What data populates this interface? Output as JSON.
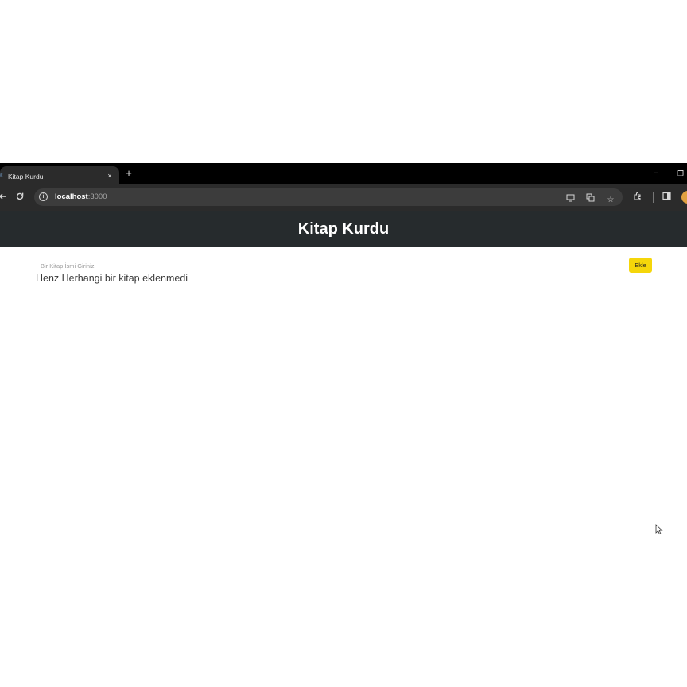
{
  "browser": {
    "tab_title": "Kitap Kurdu",
    "tab_close": "×",
    "new_tab": "+",
    "window_minimize": "–",
    "window_restore": "❐",
    "url_host": "localhost",
    "url_port": ":3000",
    "icons": {
      "back": "arrow-left-icon",
      "reload": "reload-icon",
      "info": "info-icon",
      "cast": "cast-icon",
      "translate": "translate-icon",
      "bookmark": "star-icon",
      "extensions": "puzzle-icon",
      "sidepanel": "side-panel-icon"
    }
  },
  "app": {
    "title": "Kitap Kurdu",
    "input_placeholder": "Bir Kitap İsmi Giriniz",
    "input_value": "",
    "add_button_label": "Ekle",
    "empty_message": "Henz Herhangi bir kitap eklenmedi"
  },
  "colors": {
    "header_bg": "#262b2d",
    "button_bg": "#f5d60a",
    "browser_chrome": "#2b2b2b"
  }
}
